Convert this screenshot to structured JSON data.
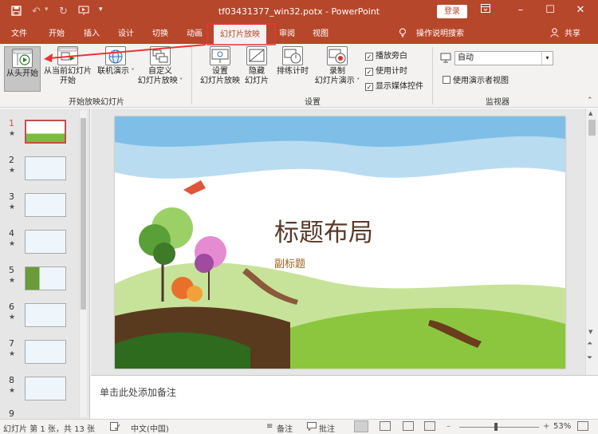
{
  "window": {
    "title": "tf03431377_win32.potx  -  PowerPoint",
    "login_label": "登录"
  },
  "tabs": [
    {
      "label": "文件"
    },
    {
      "label": "开始"
    },
    {
      "label": "插入"
    },
    {
      "label": "设计"
    },
    {
      "label": "切换"
    },
    {
      "label": "动画"
    },
    {
      "label": "幻灯片放映"
    },
    {
      "label": "审阅"
    },
    {
      "label": "视图"
    }
  ],
  "tell_me": "操作说明搜索",
  "share": "共享",
  "ribbon": {
    "from_beginning": "从头开始",
    "from_current_1": "从当前幻灯片",
    "from_current_2": "开始",
    "online_1": "联机演示",
    "custom_1": "自定义",
    "custom_2": "幻灯片放映",
    "group1": "开始放映幻灯片",
    "setup_1": "设置",
    "setup_2": "幻灯片放映",
    "hide_1": "隐藏",
    "hide_2": "幻灯片",
    "rehearse": "排练计时",
    "record_1": "录制",
    "record_2": "幻灯片演示",
    "play_narrations": "播放旁白",
    "use_timings": "使用计时",
    "show_media": "显示媒体控件",
    "group2": "设置",
    "monitor_value": "自动",
    "presenter_view": "使用演示者视图",
    "group3": "监视器"
  },
  "thumbnails": [
    {
      "num": "1",
      "star": "★"
    },
    {
      "num": "2",
      "star": "★"
    },
    {
      "num": "3",
      "star": "★"
    },
    {
      "num": "4",
      "star": "★"
    },
    {
      "num": "5",
      "star": "★"
    },
    {
      "num": "6",
      "star": "★"
    },
    {
      "num": "7",
      "star": "★"
    },
    {
      "num": "8",
      "star": "★"
    },
    {
      "num": "9",
      "star": "★"
    }
  ],
  "slide": {
    "title": "标题布局",
    "subtitle": "副标题"
  },
  "notes_placeholder": "单击此处添加备注",
  "status": {
    "slide_info": "幻灯片 第 1 张，共 13 张",
    "language": "中文(中国)",
    "notes": "备注",
    "comments": "批注",
    "zoom": "53%"
  },
  "colors": {
    "accent": "#b7472a",
    "ribbon_bg": "#f3f2f1"
  }
}
